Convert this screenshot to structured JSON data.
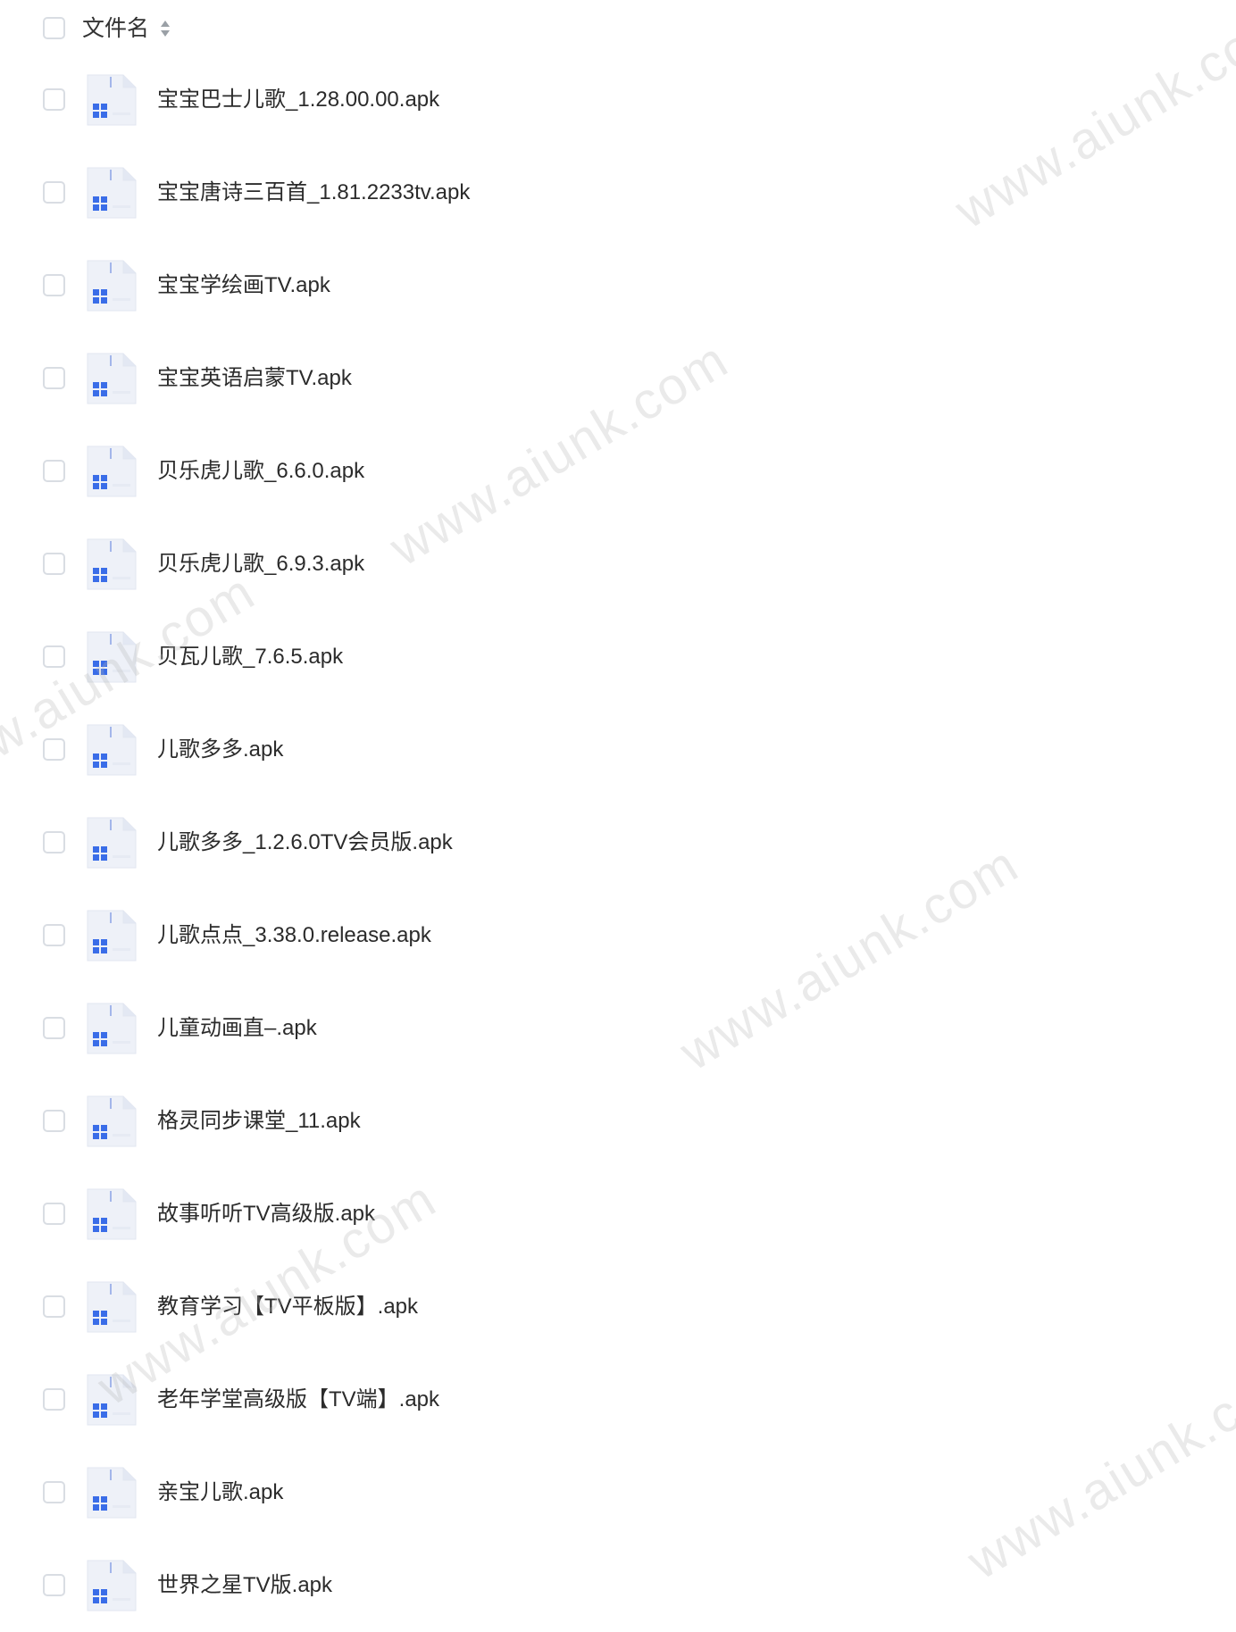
{
  "header": {
    "column_label": "文件名"
  },
  "files": [
    {
      "name": "宝宝巴士儿歌_1.28.00.00.apk"
    },
    {
      "name": "宝宝唐诗三百首_1.81.2233tv.apk"
    },
    {
      "name": "宝宝学绘画TV.apk"
    },
    {
      "name": "宝宝英语启蒙TV.apk"
    },
    {
      "name": "贝乐虎儿歌_6.6.0.apk"
    },
    {
      "name": "贝乐虎儿歌_6.9.3.apk"
    },
    {
      "name": "贝瓦儿歌_7.6.5.apk"
    },
    {
      "name": "儿歌多多.apk"
    },
    {
      "name": "儿歌多多_1.2.6.0TV会员版.apk"
    },
    {
      "name": "儿歌点点_3.38.0.release.apk"
    },
    {
      "name": "儿童动画直–.apk"
    },
    {
      "name": "格灵同步课堂_11.apk"
    },
    {
      "name": "故事听听TV高级版.apk"
    },
    {
      "name": "教育学习【TV平板版】.apk"
    },
    {
      "name": "老年学堂高级版【TV端】.apk"
    },
    {
      "name": "亲宝儿歌.apk"
    },
    {
      "name": "世界之星TV版.apk"
    }
  ],
  "watermark": {
    "text": "www.aiunk.com"
  },
  "colors": {
    "file_icon_accent": "#3a6de8",
    "checkbox_border": "#d9dde3",
    "text": "#2b2b2b"
  },
  "icons": {
    "file_type": "apk-file-icon",
    "sort": "sort-icon"
  }
}
